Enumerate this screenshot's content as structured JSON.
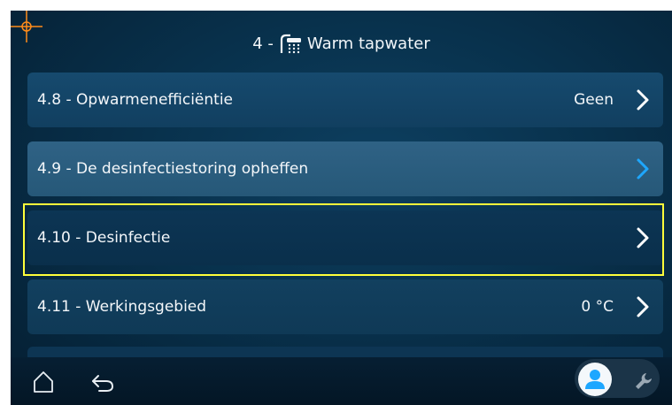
{
  "header": {
    "number": "4 -",
    "title": "Warm tapwater",
    "icon": "shower-icon"
  },
  "rows": [
    {
      "label": "4.8 - Opwarmenefficiëntie",
      "value": "Geen"
    },
    {
      "label": "4.9 - De desinfectiestoring opheffen",
      "value": ""
    },
    {
      "label": "4.10 - Desinfectie",
      "value": ""
    },
    {
      "label": "4.11 - Werkingsgebied",
      "value": "0 °C"
    }
  ],
  "icons": {
    "home": "home-icon",
    "back": "back-arrow-icon",
    "user": "user-icon",
    "wrench": "wrench-icon",
    "chevron": "chevron-right-icon"
  },
  "colors": {
    "highlight": "#ffff3a",
    "chevron_accent": "#1ea7ff",
    "crosshair": "#ff8c1a"
  }
}
